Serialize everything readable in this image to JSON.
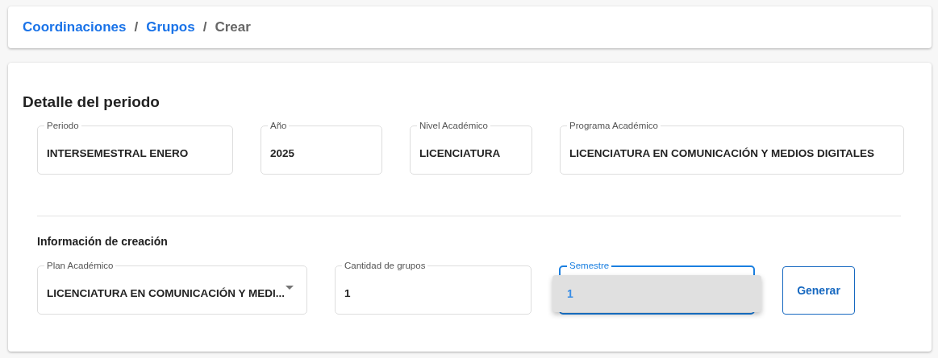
{
  "breadcrumb": [
    {
      "label": "Coordinaciones",
      "kind": "link"
    },
    {
      "label": "/",
      "kind": "separator"
    },
    {
      "label": "Grupos",
      "kind": "link"
    },
    {
      "label": "/",
      "kind": "separator"
    },
    {
      "label": "Crear",
      "kind": "current"
    }
  ],
  "period_detail": {
    "title": "Detalle del periodo",
    "fields": [
      {
        "label": "Periodo",
        "value": "INTERSEMESTRAL ENERO",
        "kind": "text",
        "focused": false
      },
      {
        "label": "Año",
        "value": "2025",
        "kind": "text",
        "focused": false
      },
      {
        "label": "Nivel Académico",
        "value": "LICENCIATURA",
        "kind": "text",
        "focused": false
      },
      {
        "label": "Programa Académico",
        "value": "LICENCIATURA EN COMUNICACIÓN Y MEDIOS DIGITALES",
        "kind": "text",
        "focused": false
      }
    ]
  },
  "creation_info": {
    "title": "Información de creación",
    "fields": [
      {
        "label": "Plan Académico",
        "value": "LICENCIATURA EN COMUNICACIÓN Y MEDI...",
        "kind": "select",
        "focused": false
      },
      {
        "label": "Cantidad de grupos",
        "value": "1",
        "kind": "text",
        "focused": false
      },
      {
        "label": "Semestre",
        "kind": "select",
        "focused": true,
        "menu": {
          "open": true,
          "options": [
            {
              "label": "1",
              "selected": true
            }
          ]
        }
      }
    ],
    "button": "Generar"
  }
}
